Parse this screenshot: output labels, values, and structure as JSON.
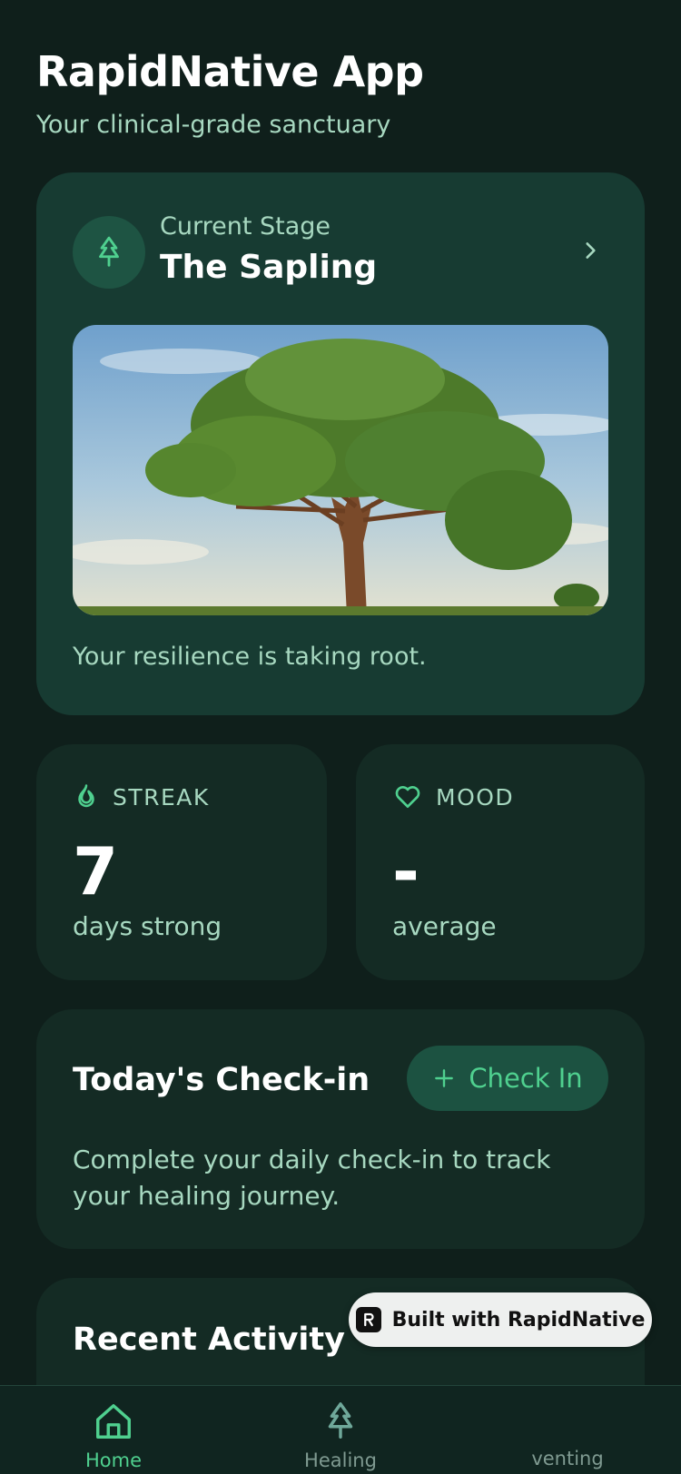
{
  "header": {
    "title": "RapidNative App",
    "subtitle": "Your clinical-grade sanctuary"
  },
  "stage_card": {
    "label": "Current Stage",
    "name": "The Sapling",
    "icon": "tree-icon",
    "message": "Your resilience is taking root."
  },
  "stats": {
    "streak": {
      "label": "STREAK",
      "value": "7",
      "caption": "days strong",
      "icon": "flame-icon"
    },
    "mood": {
      "label": "MOOD",
      "value": "-",
      "caption": "average",
      "icon": "heart-icon"
    }
  },
  "checkin": {
    "title": "Today's Check-in",
    "button_label": "Check In",
    "description": "Complete your daily check-in to track your healing journey."
  },
  "activity": {
    "title": "Recent Activity"
  },
  "badge": {
    "text": "Built with RapidNative"
  },
  "tabs": [
    {
      "label": "Home",
      "icon": "home-icon",
      "active": true
    },
    {
      "label": "Healing",
      "icon": "tree-icon",
      "active": false
    },
    {
      "label": "venting",
      "icon": "",
      "active": false
    }
  ],
  "colors": {
    "background": "#0f1f1b",
    "card": "#173b32",
    "accent": "#4fd08f",
    "muted_text": "#a7d8c0"
  }
}
